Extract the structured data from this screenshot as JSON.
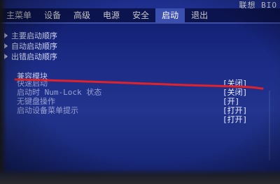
{
  "brand": "联想 BIO",
  "menu": {
    "items": [
      {
        "label": "主菜单"
      },
      {
        "label": "设备"
      },
      {
        "label": "高级"
      },
      {
        "label": "电源"
      },
      {
        "label": "安全"
      },
      {
        "label": "启动"
      },
      {
        "label": "退出"
      }
    ],
    "active_index": 5
  },
  "submenus": [
    {
      "label": "主要启动顺序"
    },
    {
      "label": "自动启动顺序"
    },
    {
      "label": "出错启动顺序"
    }
  ],
  "section_label": "兼容模块",
  "settings": [
    {
      "label": "快速启动",
      "value": "[关闭]"
    },
    {
      "label": "启动时 Num-Lock 状态",
      "value": "[关闭]"
    },
    {
      "label": "无键盘操作",
      "value": "[开]"
    },
    {
      "label": "启动设备菜单提示",
      "value": "[打开]"
    },
    {
      "label": "",
      "value": "[打开]"
    }
  ],
  "colors": {
    "background": "#1c2c86",
    "menubar": "#0c1450",
    "active_tab": "#3a4fb0",
    "annotation": "#e0232a"
  }
}
